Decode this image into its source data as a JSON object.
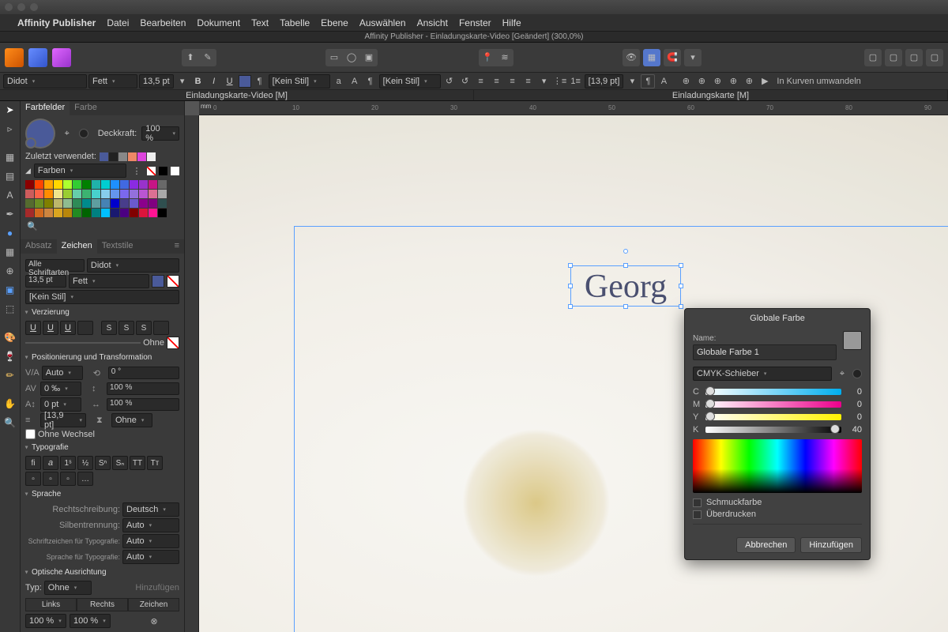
{
  "app": {
    "name": "Affinity Publisher"
  },
  "menu": [
    "Datei",
    "Bearbeiten",
    "Dokument",
    "Text",
    "Tabelle",
    "Ebene",
    "Auswählen",
    "Ansicht",
    "Fenster",
    "Hilfe"
  ],
  "document_title": "Affinity Publisher - Einladungskarte-Video [Geändert] (300,0%)",
  "tabs": [
    "Einladungskarte-Video [M]",
    "Einladungskarte [M]"
  ],
  "optbar": {
    "font": "Didot",
    "weight": "Fett",
    "size": "13,5 pt",
    "charstyle": "[Kein Stil]",
    "parastyle": "[Kein Stil]",
    "baseline": "[13,9 pt]",
    "convert": "In Kurven umwandeln"
  },
  "left": {
    "tabs1": [
      "Farbfelder",
      "Farbe"
    ],
    "opacity_label": "Deckkraft:",
    "opacity": "100 %",
    "recent_label": "Zuletzt verwendet:",
    "palette": "Farben",
    "tabs2": [
      "Absatz",
      "Zeichen",
      "Textstile"
    ],
    "all_fonts": "Alle Schriftarten",
    "font": "Didot",
    "size": "13,5 pt",
    "weight": "Fett",
    "style": "[Kein Stil]",
    "sec_decor": "Verzierung",
    "ohne": "Ohne",
    "sec_pos": "Positionierung und Transformation",
    "kern": "Auto",
    "track": "0 ‰",
    "baseline_shift": "0 pt",
    "leading": "[13,9 pt]",
    "rot": "0 °",
    "hscale": "100 %",
    "vscale": "100 %",
    "shear": "Ohne",
    "no_change": "Ohne Wechsel",
    "sec_typo": "Typografie",
    "sec_lang": "Sprache",
    "spell_l": "Rechtschreibung:",
    "spell": "Deutsch",
    "hyph_l": "Silbentrennung:",
    "hyph": "Auto",
    "typochar_l": "Schriftzeichen für Typografie:",
    "typochar": "Auto",
    "typolang_l": "Sprache für Typografie:",
    "typolang": "Auto",
    "sec_opt": "Optische Ausrichtung",
    "type_l": "Typ:",
    "type": "Ohne",
    "add": "Hinzufügen",
    "foot": [
      "Links",
      "Rechts",
      "Zeichen"
    ],
    "pct": "100 %"
  },
  "ruler": {
    "unit": "mm",
    "marks": [
      "0",
      "10",
      "20",
      "30",
      "40",
      "50",
      "60",
      "70",
      "80",
      "90"
    ]
  },
  "text_content": "Georg",
  "popup": {
    "title": "Globale Farbe",
    "name_l": "Name:",
    "name": "Globale Farbe 1",
    "mode": "CMYK-Schieber",
    "c": {
      "l": "C",
      "v": "0",
      "pos": 0
    },
    "m": {
      "l": "M",
      "v": "0",
      "pos": 0
    },
    "y": {
      "l": "Y",
      "v": "0",
      "pos": 0
    },
    "k": {
      "l": "K",
      "v": "40",
      "pos": 92
    },
    "spot": "Schmuckfarbe",
    "overprint": "Überdrucken",
    "cancel": "Abbrechen",
    "ok": "Hinzufügen"
  }
}
